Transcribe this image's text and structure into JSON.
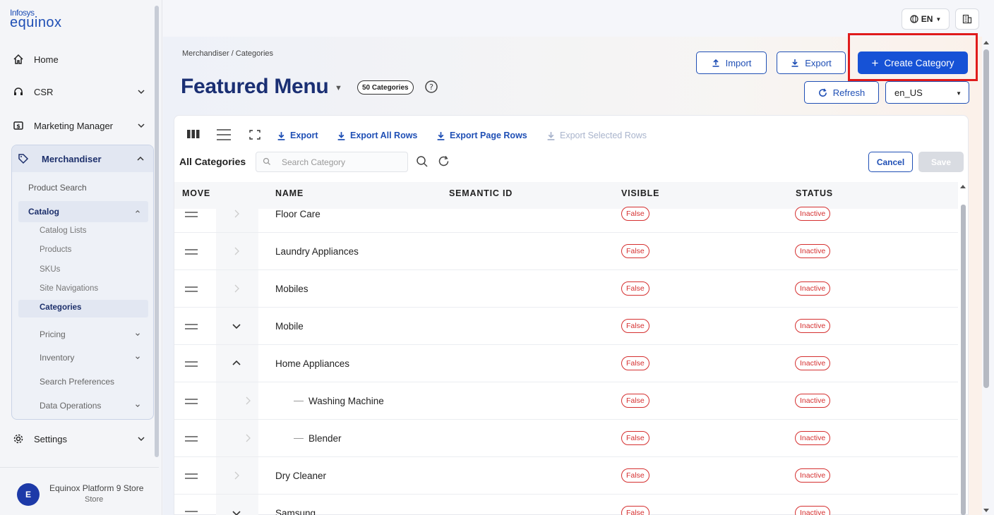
{
  "brand": {
    "line1": "Infosys",
    "line2": "equinox"
  },
  "sidebar": {
    "items": [
      {
        "label": "Home"
      },
      {
        "label": "CSR"
      },
      {
        "label": "Marketing Manager"
      },
      {
        "label": "Merchandiser"
      },
      {
        "label": "Settings"
      }
    ],
    "merch_sub": [
      {
        "label": "Product Search"
      },
      {
        "label": "Catalog"
      },
      {
        "label": "Pricing"
      },
      {
        "label": "Inventory"
      },
      {
        "label": "Search Preferences"
      },
      {
        "label": "Data Operations"
      }
    ],
    "catalog_sub": [
      {
        "label": "Catalog Lists"
      },
      {
        "label": "Products"
      },
      {
        "label": "SKUs"
      },
      {
        "label": "Site Navigations"
      },
      {
        "label": "Categories"
      }
    ],
    "user": {
      "initial": "E",
      "name": "Equinox Platform 9 Store",
      "role": "Store"
    }
  },
  "header": {
    "lang": "EN"
  },
  "page": {
    "breadcrumb": "Merchandiser  /  Categories",
    "title": "Featured Menu",
    "count": "50 Categories",
    "import_label": "Import",
    "export_label": "Export",
    "create_label": "Create Category",
    "refresh_label": "Refresh",
    "locale": "en_US"
  },
  "toolbar": {
    "export": "Export",
    "export_all": "Export All Rows",
    "export_page": "Export Page Rows",
    "export_selected": "Export Selected Rows",
    "all_categories": "All Categories",
    "search_placeholder": "Search Category",
    "cancel": "Cancel",
    "save": "Save"
  },
  "table": {
    "headers": {
      "move": "MOVE",
      "name": "NAME",
      "semantic_id": "SEMANTIC ID",
      "visible": "VISIBLE",
      "status": "STATUS"
    },
    "rows": [
      {
        "name": "Floor Care",
        "visible": "False",
        "status": "Inactive"
      },
      {
        "name": "Laundry Appliances",
        "visible": "False",
        "status": "Inactive"
      },
      {
        "name": "Mobiles",
        "visible": "False",
        "status": "Inactive"
      },
      {
        "name": "Mobile",
        "visible": "False",
        "status": "Inactive"
      },
      {
        "name": "Home Appliances",
        "visible": "False",
        "status": "Inactive"
      },
      {
        "name": "Washing Machine",
        "visible": "False",
        "status": "Inactive"
      },
      {
        "name": "Blender",
        "visible": "False",
        "status": "Inactive"
      },
      {
        "name": "Dry Cleaner",
        "visible": "False",
        "status": "Inactive"
      },
      {
        "name": "Samsung",
        "visible": "False",
        "status": "Inactive"
      }
    ]
  },
  "colors": {
    "primary": "#1652d6",
    "title": "#1a2f73",
    "danger": "#d53030",
    "highlight": "#e01b1b"
  }
}
